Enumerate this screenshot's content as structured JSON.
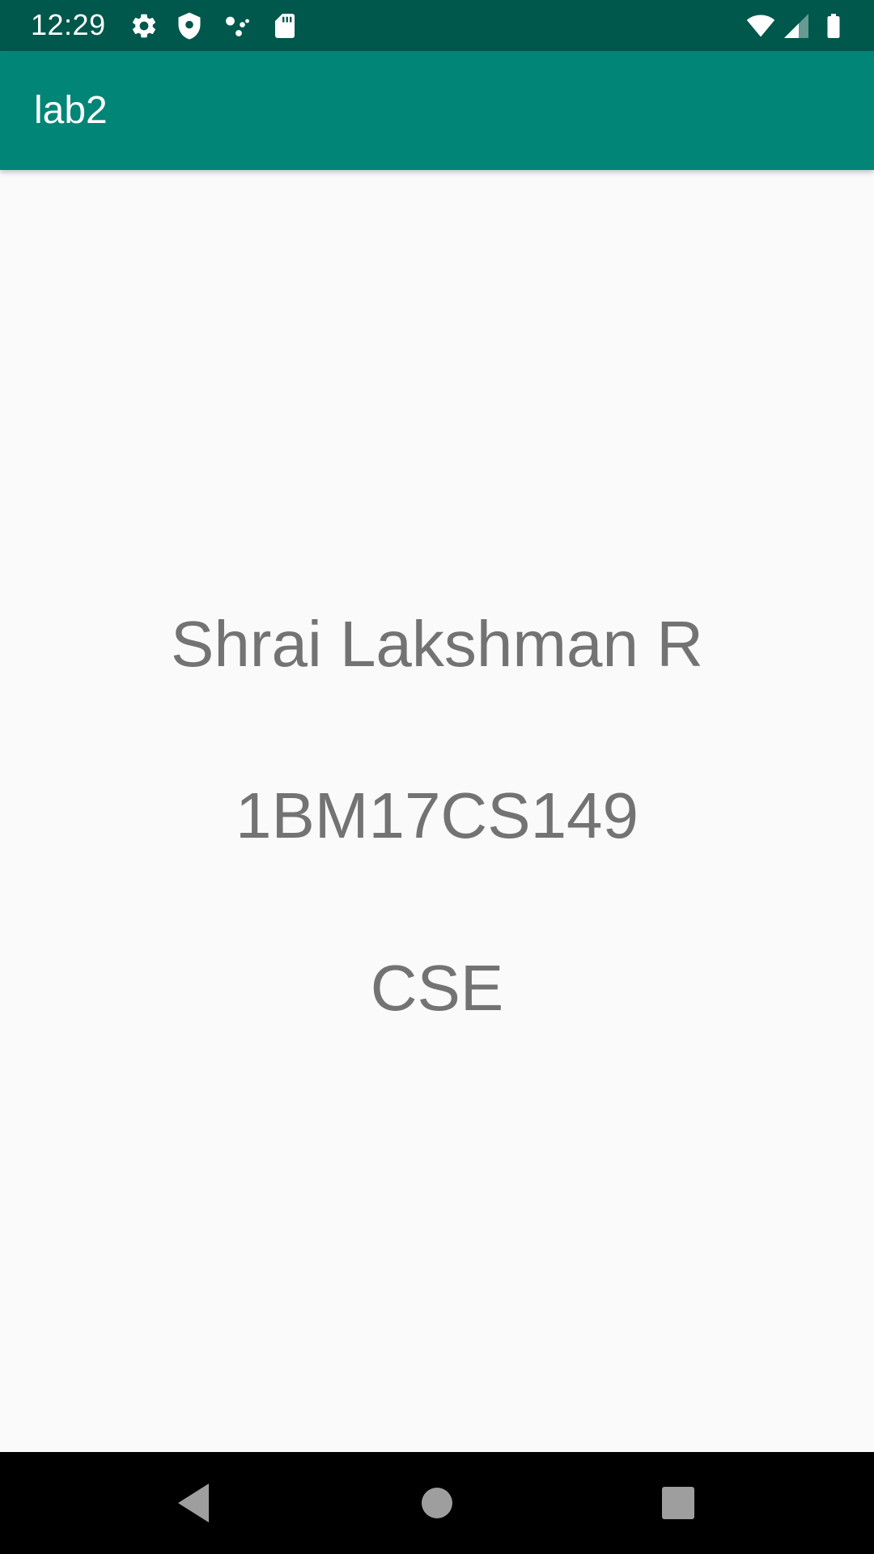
{
  "status_bar": {
    "time": "12:29",
    "background": "#00574b",
    "icons_left": [
      "settings-icon",
      "shield-icon",
      "assistant-dots-icon",
      "sd-card-icon"
    ],
    "icons_right": [
      "wifi-icon",
      "cellular-signal-icon",
      "battery-icon"
    ]
  },
  "app_bar": {
    "title": "lab2",
    "background": "#008577"
  },
  "main": {
    "lines": [
      {
        "text": "Shrai Lakshman R"
      },
      {
        "text": "1BM17CS149"
      },
      {
        "text": "CSE"
      }
    ],
    "text_color": "#737373",
    "background": "#fafafa"
  },
  "nav_bar": {
    "buttons": [
      "back-icon",
      "home-icon",
      "recents-icon"
    ]
  }
}
